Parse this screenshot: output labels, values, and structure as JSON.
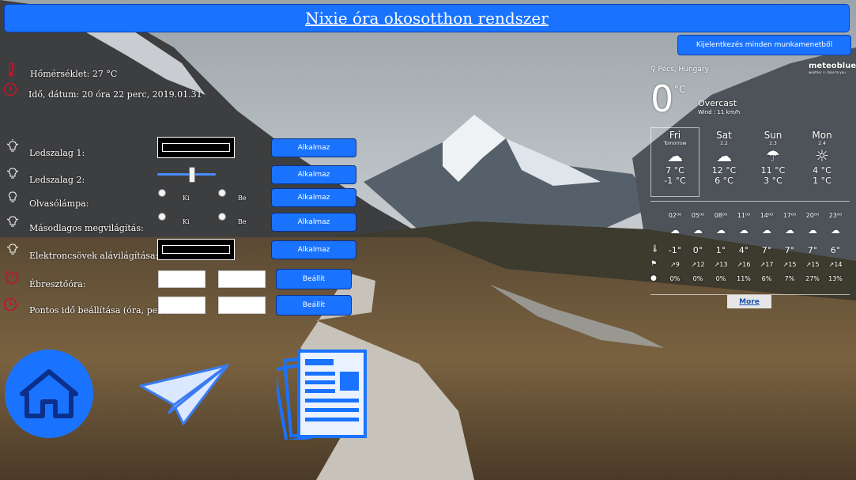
{
  "header": {
    "title": "Nixie óra okosotthon rendszer",
    "logout_label": "Kijelentkezés minden munkamenetből"
  },
  "status": {
    "temperature": "Hőmérséklet: 27 °C",
    "datetime": "Idő, dátum: 20 óra 22 perc, 2019.01.31"
  },
  "controls": {
    "led1_label": "Ledszalag 1:",
    "led2_label": "Ledszalag 2:",
    "reading_lamp_label": "Olvasólámpa:",
    "secondary_light_label": "Másodlagos megvilágítás:",
    "tube_light_label": "Elektroncsövek alávilágítása:",
    "alarm_label": "Ébresztőóra:",
    "time_set_label": "Pontos idő beállítása (óra, perc):",
    "apply_label": "Alkalmaz",
    "set_label": "Beállít",
    "off_label": "Ki",
    "on_label": "Be",
    "led2_slider_level": 0.6
  },
  "weather": {
    "location": "Pécs, Hungary",
    "brand": "meteoblue",
    "brand_tagline": "weather ☉ close to you",
    "current_temp": "0",
    "unit": "°C",
    "condition": "Overcast",
    "wind": "Wind : 11 km/h",
    "days": [
      {
        "name": "Fri",
        "sub": "Tomorrow",
        "hi": "7 °C",
        "lo": "-1 °C"
      },
      {
        "name": "Sat",
        "sub": "2.2",
        "hi": "12 °C",
        "lo": "6 °C"
      },
      {
        "name": "Sun",
        "sub": "2.3",
        "hi": "11 °C",
        "lo": "3 °C"
      },
      {
        "name": "Mon",
        "sub": "2.4",
        "hi": "4 °C",
        "lo": "1 °C"
      }
    ],
    "hours": [
      "02⁰⁰",
      "05⁰⁰",
      "08⁰⁰",
      "11⁰⁰",
      "14⁰⁰",
      "17⁰⁰",
      "20⁰⁰",
      "23⁰⁰"
    ],
    "temps": [
      "-1°",
      "0°",
      "1°",
      "4°",
      "7°",
      "7°",
      "7°",
      "6°"
    ],
    "winds": [
      "9",
      "12",
      "13",
      "16",
      "17",
      "15",
      "15",
      "14"
    ],
    "precip": [
      "0%",
      "0%",
      "0%",
      "11%",
      "6%",
      "7%",
      "27%",
      "13%"
    ],
    "more_label": "More"
  },
  "icons": {
    "thermometer": "thermometer-icon",
    "clock": "clock-icon",
    "bulb": "lightbulb-icon",
    "alarm": "alarm-clock-icon",
    "home": "home-icon",
    "send": "paper-plane-icon",
    "news": "newspaper-icon"
  },
  "colors": {
    "accent": "#1a73ff",
    "icon_red": "#c0162b"
  }
}
